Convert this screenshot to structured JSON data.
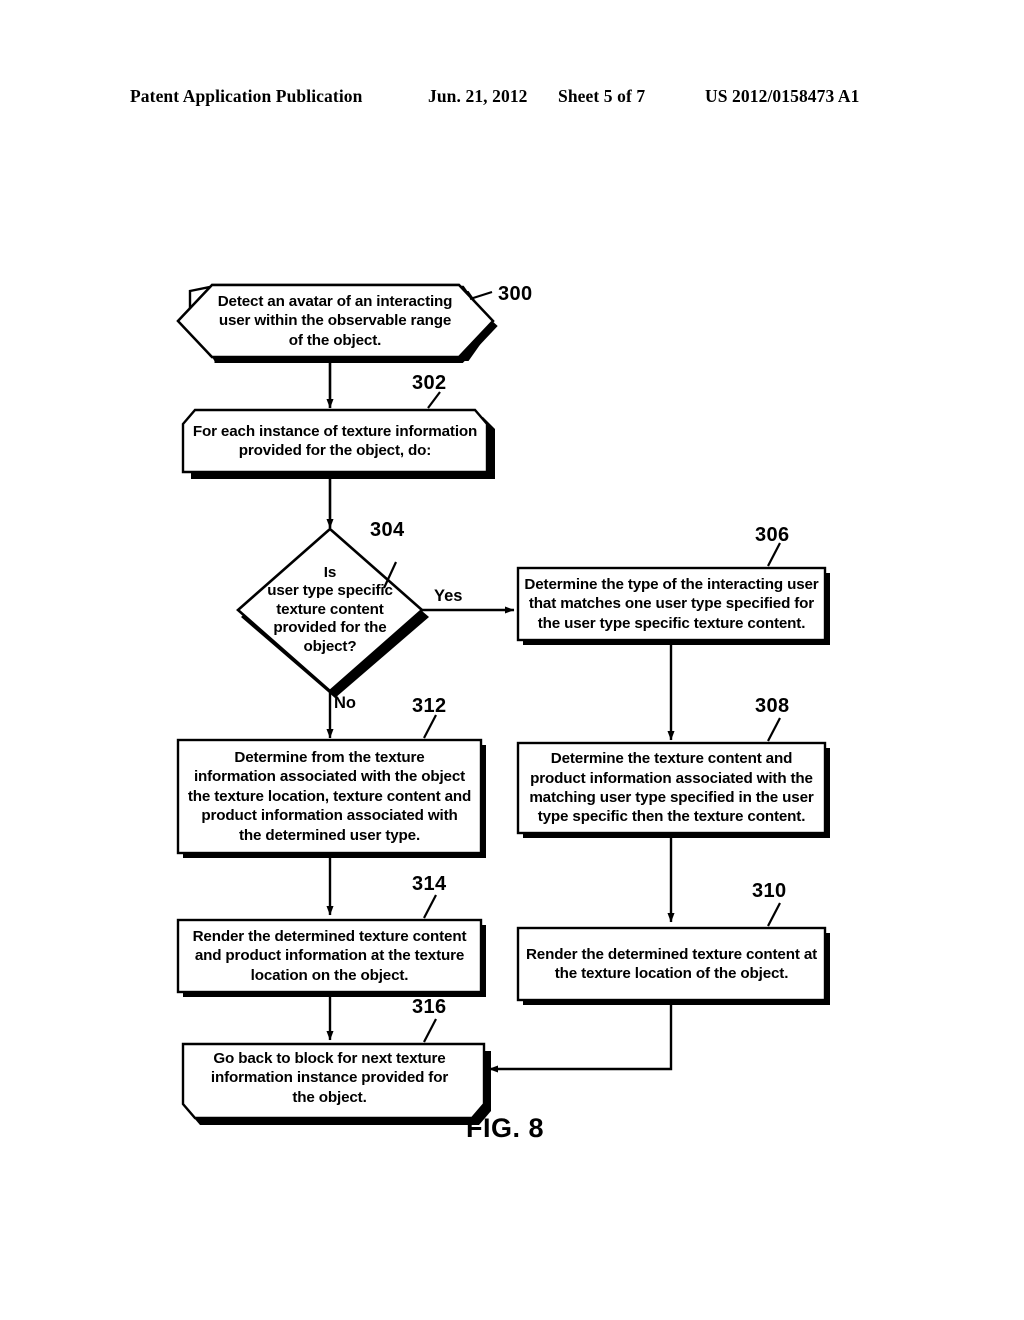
{
  "header": {
    "publication": "Patent Application Publication",
    "date": "Jun. 21, 2012",
    "sheet": "Sheet 5 of 7",
    "patent_number": "US 2012/0158473 A1"
  },
  "figure": {
    "caption": "FIG. 8",
    "line_color": "#000000",
    "fill_color": "#ffffff"
  },
  "nodes": [
    {
      "ref": "300",
      "shape": "hexagon",
      "text": "Detect an avatar of an interacting\nuser within the observable range\nof the object."
    },
    {
      "ref": "302",
      "shape": "loop-start",
      "text": "For each instance of texture information\nprovided for the object, do:"
    },
    {
      "ref": "304",
      "shape": "diamond",
      "text": "Is\nuser type specific\ntexture content\nprovided for the\nobject?"
    },
    {
      "ref": "306",
      "shape": "rectangle",
      "text": "Determine the type of the interacting user\nthat matches one user type specified for\nthe user type specific texture content."
    },
    {
      "ref": "308",
      "shape": "rectangle",
      "text": "Determine the texture content and\nproduct information associated with the\nmatching user type specified in the user\ntype specific then the texture content."
    },
    {
      "ref": "310",
      "shape": "rectangle",
      "text": "Render the determined texture content at\nthe texture location of the object."
    },
    {
      "ref": "312",
      "shape": "rectangle",
      "text": "Determine from the texture\ninformation associated with the object\nthe texture location, texture content and\nproduct information associated with\nthe determined user type."
    },
    {
      "ref": "314",
      "shape": "rectangle",
      "text": "Render the determined texture content\nand product information at the texture\nlocation on the object."
    },
    {
      "ref": "316",
      "shape": "loop-end",
      "text": "Go back to block for next texture\ninformation instance provided for\nthe object."
    }
  ],
  "edges": [
    {
      "from": "300",
      "to": "302",
      "label": ""
    },
    {
      "from": "302",
      "to": "304",
      "label": ""
    },
    {
      "from": "304",
      "to": "306",
      "label": "Yes"
    },
    {
      "from": "304",
      "to": "312",
      "label": "No"
    },
    {
      "from": "306",
      "to": "308",
      "label": ""
    },
    {
      "from": "308",
      "to": "310",
      "label": ""
    },
    {
      "from": "310",
      "to": "316",
      "label": ""
    },
    {
      "from": "312",
      "to": "314",
      "label": ""
    },
    {
      "from": "314",
      "to": "316",
      "label": ""
    }
  ]
}
